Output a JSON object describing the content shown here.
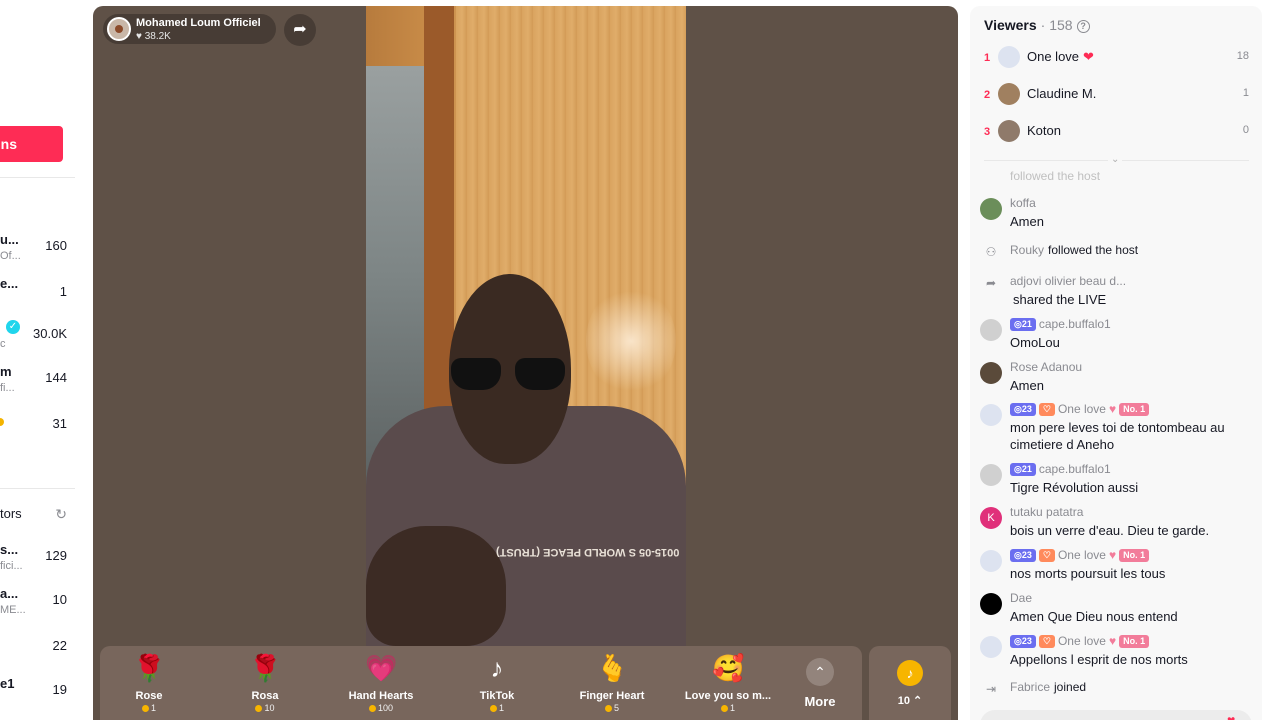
{
  "sidebar": {
    "go_live_label": "ns",
    "accounts": [
      {
        "name": "u...",
        "sub": "Of...",
        "count": "160"
      },
      {
        "name": "e...",
        "sub": "",
        "count": "1"
      },
      {
        "name": "",
        "sub": "c",
        "count": "30.0K",
        "verified": true
      },
      {
        "name": "m",
        "sub": "fi...",
        "count": "144"
      },
      {
        "name": "",
        "sub": "",
        "count": "31"
      }
    ],
    "section_label": "tors",
    "creators": [
      {
        "name": "s...",
        "sub": "fici...",
        "count": "129"
      },
      {
        "name": "a...",
        "sub": "ME...",
        "count": "10"
      },
      {
        "name": "",
        "sub": "",
        "count": "22"
      },
      {
        "name": "e1",
        "sub": "",
        "count": "19"
      }
    ]
  },
  "stream": {
    "host_name": "Mohamed Loum Officiel",
    "host_likes": "38.2K",
    "shirt_text": "0015-05 S WORLD PEACE (TRUST)"
  },
  "gifts": [
    {
      "name": "Rose",
      "cost": "1",
      "icon": "rose-icon",
      "glyph": "🌹"
    },
    {
      "name": "Rosa",
      "cost": "10",
      "icon": "rosa-icon",
      "glyph": "🌹"
    },
    {
      "name": "Hand Hearts",
      "cost": "100",
      "icon": "hand-hearts-icon",
      "glyph": "💗"
    },
    {
      "name": "TikTok",
      "cost": "1",
      "icon": "tiktok-icon",
      "glyph": "♪"
    },
    {
      "name": "Finger Heart",
      "cost": "5",
      "icon": "finger-heart-icon",
      "glyph": "🫰"
    },
    {
      "name": "Love you so m...",
      "cost": "1",
      "icon": "love-you-icon",
      "glyph": "🥰"
    }
  ],
  "more_label": "More",
  "coin_balance": "10",
  "viewers": {
    "title": "Viewers",
    "count": "158",
    "top": [
      {
        "rank": "1",
        "name": "One love",
        "heart": "❤",
        "score": "18"
      },
      {
        "rank": "2",
        "name": "Claudine M.",
        "heart": "",
        "score": "1"
      },
      {
        "rank": "3",
        "name": "Koton",
        "heart": "",
        "score": "0"
      }
    ],
    "faded_text": "followed the host"
  },
  "chat": [
    {
      "user": "koffa",
      "text": "Amen"
    },
    {
      "user": "Rouky",
      "text": "followed the host",
      "type": "follow"
    },
    {
      "user": "adjovi olivier beau d...",
      "text": "shared the LIVE",
      "type": "share"
    },
    {
      "user": "cape.buffalo1",
      "level": "21",
      "text": "OmoLou"
    },
    {
      "user": "Rose Adanou",
      "text": "Amen"
    },
    {
      "user": "One love",
      "level": "23",
      "fan": "♡",
      "rank": "No. 1",
      "text": "mon pere leves toi de tontombeau au cimetiere d Aneho"
    },
    {
      "user": "cape.buffalo1",
      "level": "21",
      "text": "Tigre Révolution aussi"
    },
    {
      "user": "tutaku patatra",
      "avatar_letter": "K",
      "text": "bois un verre d'eau. Dieu te garde."
    },
    {
      "user": "One love",
      "level": "23",
      "fan": "♡",
      "rank": "No. 1",
      "text": "nos morts poursuit les tous"
    },
    {
      "user": "Dae",
      "text": "Amen Que Dieu nous entend"
    },
    {
      "user": "One love",
      "level": "23",
      "fan": "♡",
      "rank": "No. 1",
      "text": "Appellons l esprit de nos morts"
    },
    {
      "user": "Fabrice",
      "text": "joined",
      "type": "join"
    }
  ],
  "colors": {
    "accent": "#fe2c55",
    "video_bg": "#5f5147",
    "level_badge": "#6b6ef0"
  }
}
